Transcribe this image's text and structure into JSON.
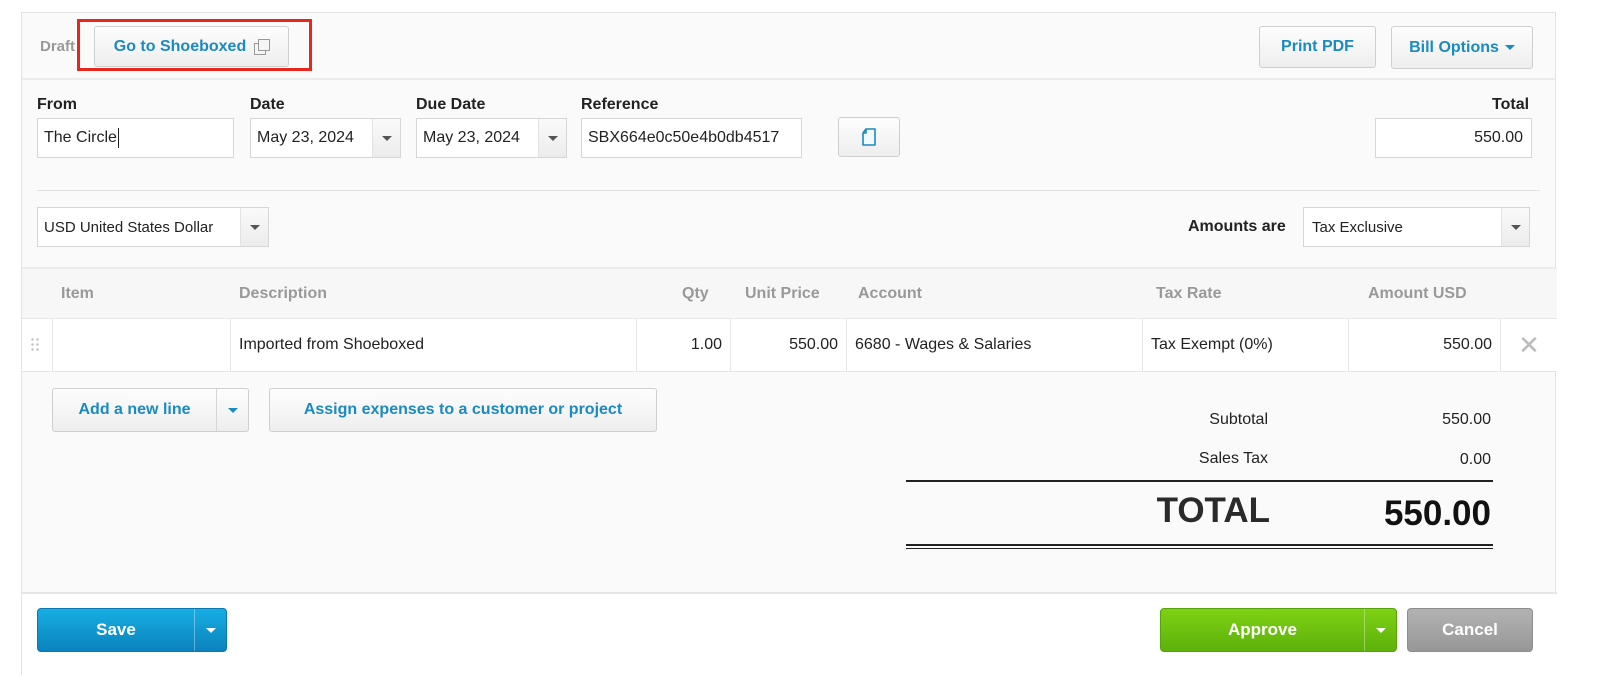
{
  "header": {
    "status": "Draft",
    "go_to_shoeboxed": "Go to Shoeboxed",
    "print_pdf": "Print PDF",
    "bill_options": "Bill Options"
  },
  "fields": {
    "from_label": "From",
    "from_value": "The Circle",
    "date_label": "Date",
    "date_value": "May 23, 2024",
    "due_date_label": "Due Date",
    "due_date_value": "May 23, 2024",
    "reference_label": "Reference",
    "reference_value": "SBX664e0c50e4b0db4517",
    "total_label": "Total",
    "total_value": "550.00",
    "currency_value": "USD United States Dollar",
    "amounts_are_label": "Amounts are",
    "amounts_are_value": "Tax Exclusive"
  },
  "table": {
    "columns": [
      "Item",
      "Description",
      "Qty",
      "Unit Price",
      "Account",
      "Tax Rate",
      "Amount USD"
    ],
    "rows": [
      {
        "item": "",
        "description": "Imported from Shoeboxed",
        "qty": "1.00",
        "unit_price": "550.00",
        "account": "6680 - Wages & Salaries",
        "tax_rate": "Tax Exempt (0%)",
        "amount": "550.00"
      }
    ]
  },
  "line_actions": {
    "add_line": "Add a new line",
    "assign_expenses": "Assign expenses to a customer or project"
  },
  "totals": {
    "subtotal_label": "Subtotal",
    "subtotal_value": "550.00",
    "sales_tax_label": "Sales Tax",
    "sales_tax_value": "0.00",
    "total_label": "TOTAL",
    "total_value": "550.00"
  },
  "footer": {
    "save": "Save",
    "approve": "Approve",
    "cancel": "Cancel"
  },
  "icons": {
    "external_link": "external-link-icon",
    "copy_document": "document-icon",
    "remove_row": "close-icon",
    "dropdown": "caret-down-icon",
    "drag_handle": "drag-handle-icon"
  },
  "colors": {
    "link_blue": "#1b8ac0",
    "save_blue": "#0b82bd",
    "approve_green": "#5db10b",
    "cancel_gray": "#979797",
    "highlight_red": "#e8271c"
  }
}
